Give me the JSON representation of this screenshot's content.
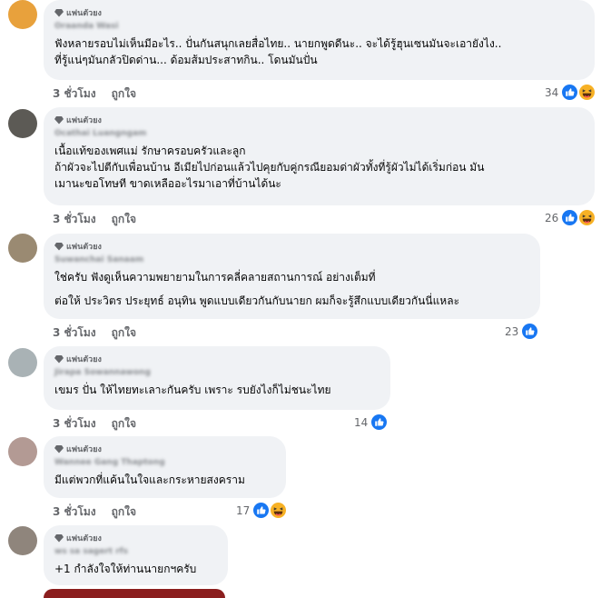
{
  "comments": [
    {
      "badge": "แฟนตัวยง",
      "name": "Oraanda Wasi",
      "lines": [
        "ฟังหลายรอบไม่เห็นมีอะไร.. ปั่นกันสนุกเลยสื่อไทย.. นายกพูดดีนะ.. จะได้รู้ฮุนเซนมันจะเอายังไง..",
        "ที่รู้แน่ๆมันกลัวปิดด่าน... ด้อมส้มประสาทกิน.. โดนมันปั่น"
      ],
      "time": "3 ชั่วโมง",
      "like": "ถูกใจ",
      "count": "34",
      "reactions": [
        "like-icon",
        "haha-icon"
      ],
      "avatar_color": "#e8a13c"
    },
    {
      "badge": "แฟนตัวยง",
      "name": "Ocathai Luangngam",
      "lines": [
        "เนื้อแท้ของเพศแม่ รักษาครอบครัวและลูก",
        "ถ้าผัวจะไปตีกับเพื่อนบ้าน อีเมียไปก่อนแล้วไปคุยกับคู่กรณียอมด่าผัวทั้งที่รู้ผัวไม่ได้เริ่มก่อน มัน",
        "เมานะขอโทษที ขาดเหลืออะไรมาเอาที่บ้านได้นะ"
      ],
      "time": "3 ชั่วโมง",
      "like": "ถูกใจ",
      "count": "26",
      "reactions": [
        "like-icon",
        "haha-icon"
      ],
      "avatar_color": "#5c5a55"
    },
    {
      "badge": "แฟนตัวยง",
      "name": "Suwanchai Sanaam",
      "lines": [
        "ใช่ครับ ฟังดูเห็นความพยายามในการคลี่คลายสถานการณ์ อย่างเต็มที่",
        "ต่อให้ ประวิตร ประยุทธ์ อนุทิน พูดแบบเดียวกันกับนายก ผมก็จะรู้สึกแบบเดียวกันนี่แหละ"
      ],
      "time": "3 ชั่วโมง",
      "like": "ถูกใจ",
      "count": "23",
      "reactions": [
        "like-icon"
      ],
      "avatar_color": "#9a8a72"
    },
    {
      "badge": "แฟนตัวยง",
      "name": "Jirapa Sowannawong",
      "lines": [
        "เขมร ปั่น ให้ไทยทะเลาะกันครับ เพราะ รบยังไงก็ไม่ชนะไทย"
      ],
      "time": "3 ชั่วโมง",
      "like": "ถูกใจ",
      "count": "14",
      "reactions": [
        "like-icon"
      ],
      "avatar_color": "#a9b2b5"
    },
    {
      "badge": "แฟนตัวยง",
      "name": "Wannee Gang Thaptong",
      "lines": [
        "มีแต่พวกที่แค้นในใจและกระหายสงคราม"
      ],
      "time": "3 ชั่วโมง",
      "like": "ถูกใจ",
      "count": "17",
      "reactions": [
        "like-icon",
        "haha-icon"
      ],
      "avatar_color": "#b39a94"
    },
    {
      "badge": "แฟนตัวยง",
      "name": "ws sa sagert rfs",
      "lines": [
        "+1 กำลังใจให้ท่านนายกฯครับ"
      ],
      "time": "",
      "like": "",
      "count": "",
      "reactions": [],
      "avatar_color": "#8f857c"
    }
  ],
  "colors": {
    "bubble": "#f0f2f5",
    "meta_text": "#65676b",
    "like_blue": "#1877f2",
    "haha_yellow": "#f7b125"
  }
}
